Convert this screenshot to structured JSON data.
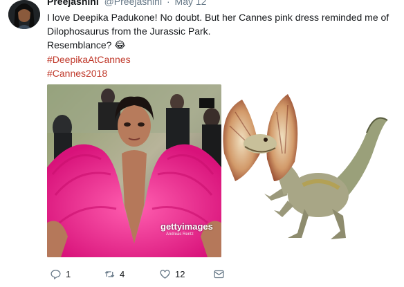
{
  "tweet": {
    "author_name": "Preejashini",
    "author_handle": "@Preejashini",
    "separator": "·",
    "date": "May 12",
    "text_line1": "I love Deepika Padukone! No doubt. But her Cannes pink dress reminded me of",
    "text_line2": "Dilophosaurus from the Jurassic Park.",
    "text_line3": "Resemblance?",
    "emoji": "😂",
    "hashtags": [
      "#DeepikaAtCannes",
      "#Cannes2018"
    ],
    "watermark": "gettyimages",
    "watermark_credit": "Andreas Rentz"
  },
  "actions": {
    "reply_count": "1",
    "retweet_count": "4",
    "like_count": "12",
    "icons": [
      "reply-icon",
      "retweet-icon",
      "like-icon",
      "message-icon"
    ]
  },
  "colors": {
    "hashtag": "#c0392b",
    "dress_pink": "#e91e8c",
    "muted": "#657786"
  }
}
